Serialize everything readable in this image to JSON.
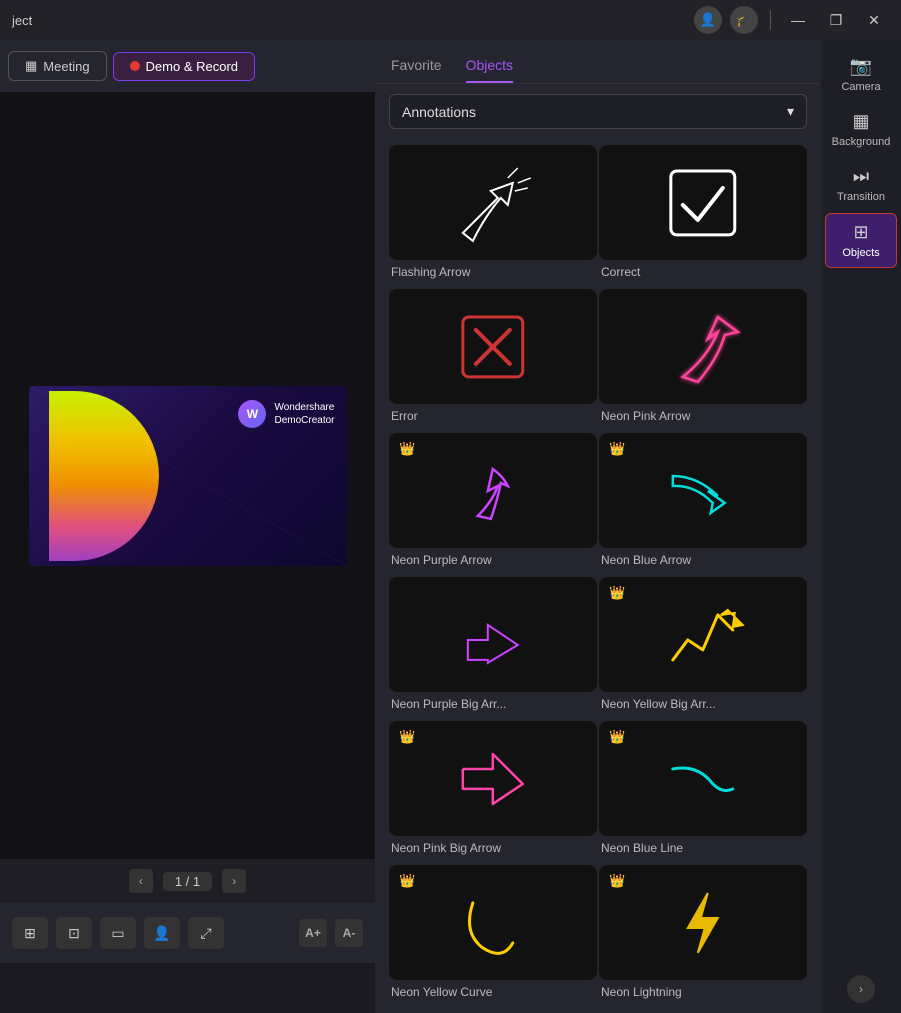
{
  "titleBar": {
    "title": "ject",
    "minimizeLabel": "—",
    "maximizeLabel": "❐",
    "closeLabel": "✕"
  },
  "topBar": {
    "meetingLabel": "Meeting",
    "demoLabel": "Demo & Record"
  },
  "tabs": {
    "favoriteLabel": "Favorite",
    "objectsLabel": "Objects"
  },
  "dropdown": {
    "label": "Annotations",
    "chevron": "▾"
  },
  "pagination": {
    "prev": "‹",
    "next": "›",
    "current": "1 / 1"
  },
  "sidebar": {
    "cameraLabel": "Camera",
    "backgroundLabel": "Background",
    "transitionLabel": "Transition",
    "objectsLabel": "Objects",
    "chevron": "›"
  },
  "objects": [
    {
      "id": "flashing-arrow",
      "label": "Flashing Arrow",
      "crown": false,
      "color": "white",
      "type": "flashing-arrow"
    },
    {
      "id": "correct",
      "label": "Correct",
      "crown": false,
      "color": "white",
      "type": "correct"
    },
    {
      "id": "error",
      "label": "Error",
      "crown": false,
      "color": "red",
      "type": "error"
    },
    {
      "id": "neon-pink-arrow",
      "label": "Neon Pink Arrow",
      "crown": false,
      "color": "pink",
      "type": "neon-pink-arrow"
    },
    {
      "id": "neon-purple-arrow",
      "label": "Neon Purple Arrow",
      "crown": true,
      "color": "purple",
      "type": "neon-purple-arrow"
    },
    {
      "id": "neon-blue-arrow",
      "label": "Neon Blue Arrow",
      "crown": true,
      "color": "cyan",
      "type": "neon-blue-arrow"
    },
    {
      "id": "neon-purple-big-arrow",
      "label": "Neon Purple Big Arr...",
      "crown": false,
      "color": "purple",
      "type": "neon-purple-big-arrow"
    },
    {
      "id": "neon-yellow-big-arrow",
      "label": "Neon Yellow Big Arr...",
      "crown": true,
      "color": "yellow",
      "type": "neon-yellow-big-arrow"
    },
    {
      "id": "neon-pink-big-arrow",
      "label": "Neon Pink Big Arrow",
      "crown": true,
      "color": "pink",
      "type": "neon-pink-big-arrow"
    },
    {
      "id": "neon-blue-line",
      "label": "Neon Blue Line",
      "crown": true,
      "color": "cyan",
      "type": "neon-blue-line"
    },
    {
      "id": "neon-yellow-curve",
      "label": "Neon Yellow Curve",
      "crown": true,
      "color": "yellow",
      "type": "neon-yellow-curve"
    },
    {
      "id": "neon-lightning",
      "label": "Neon Lightning",
      "crown": true,
      "color": "yellow",
      "type": "neon-lightning"
    }
  ],
  "bottomToolbar": {
    "textUpLabel": "A+",
    "textDownLabel": "A-"
  }
}
